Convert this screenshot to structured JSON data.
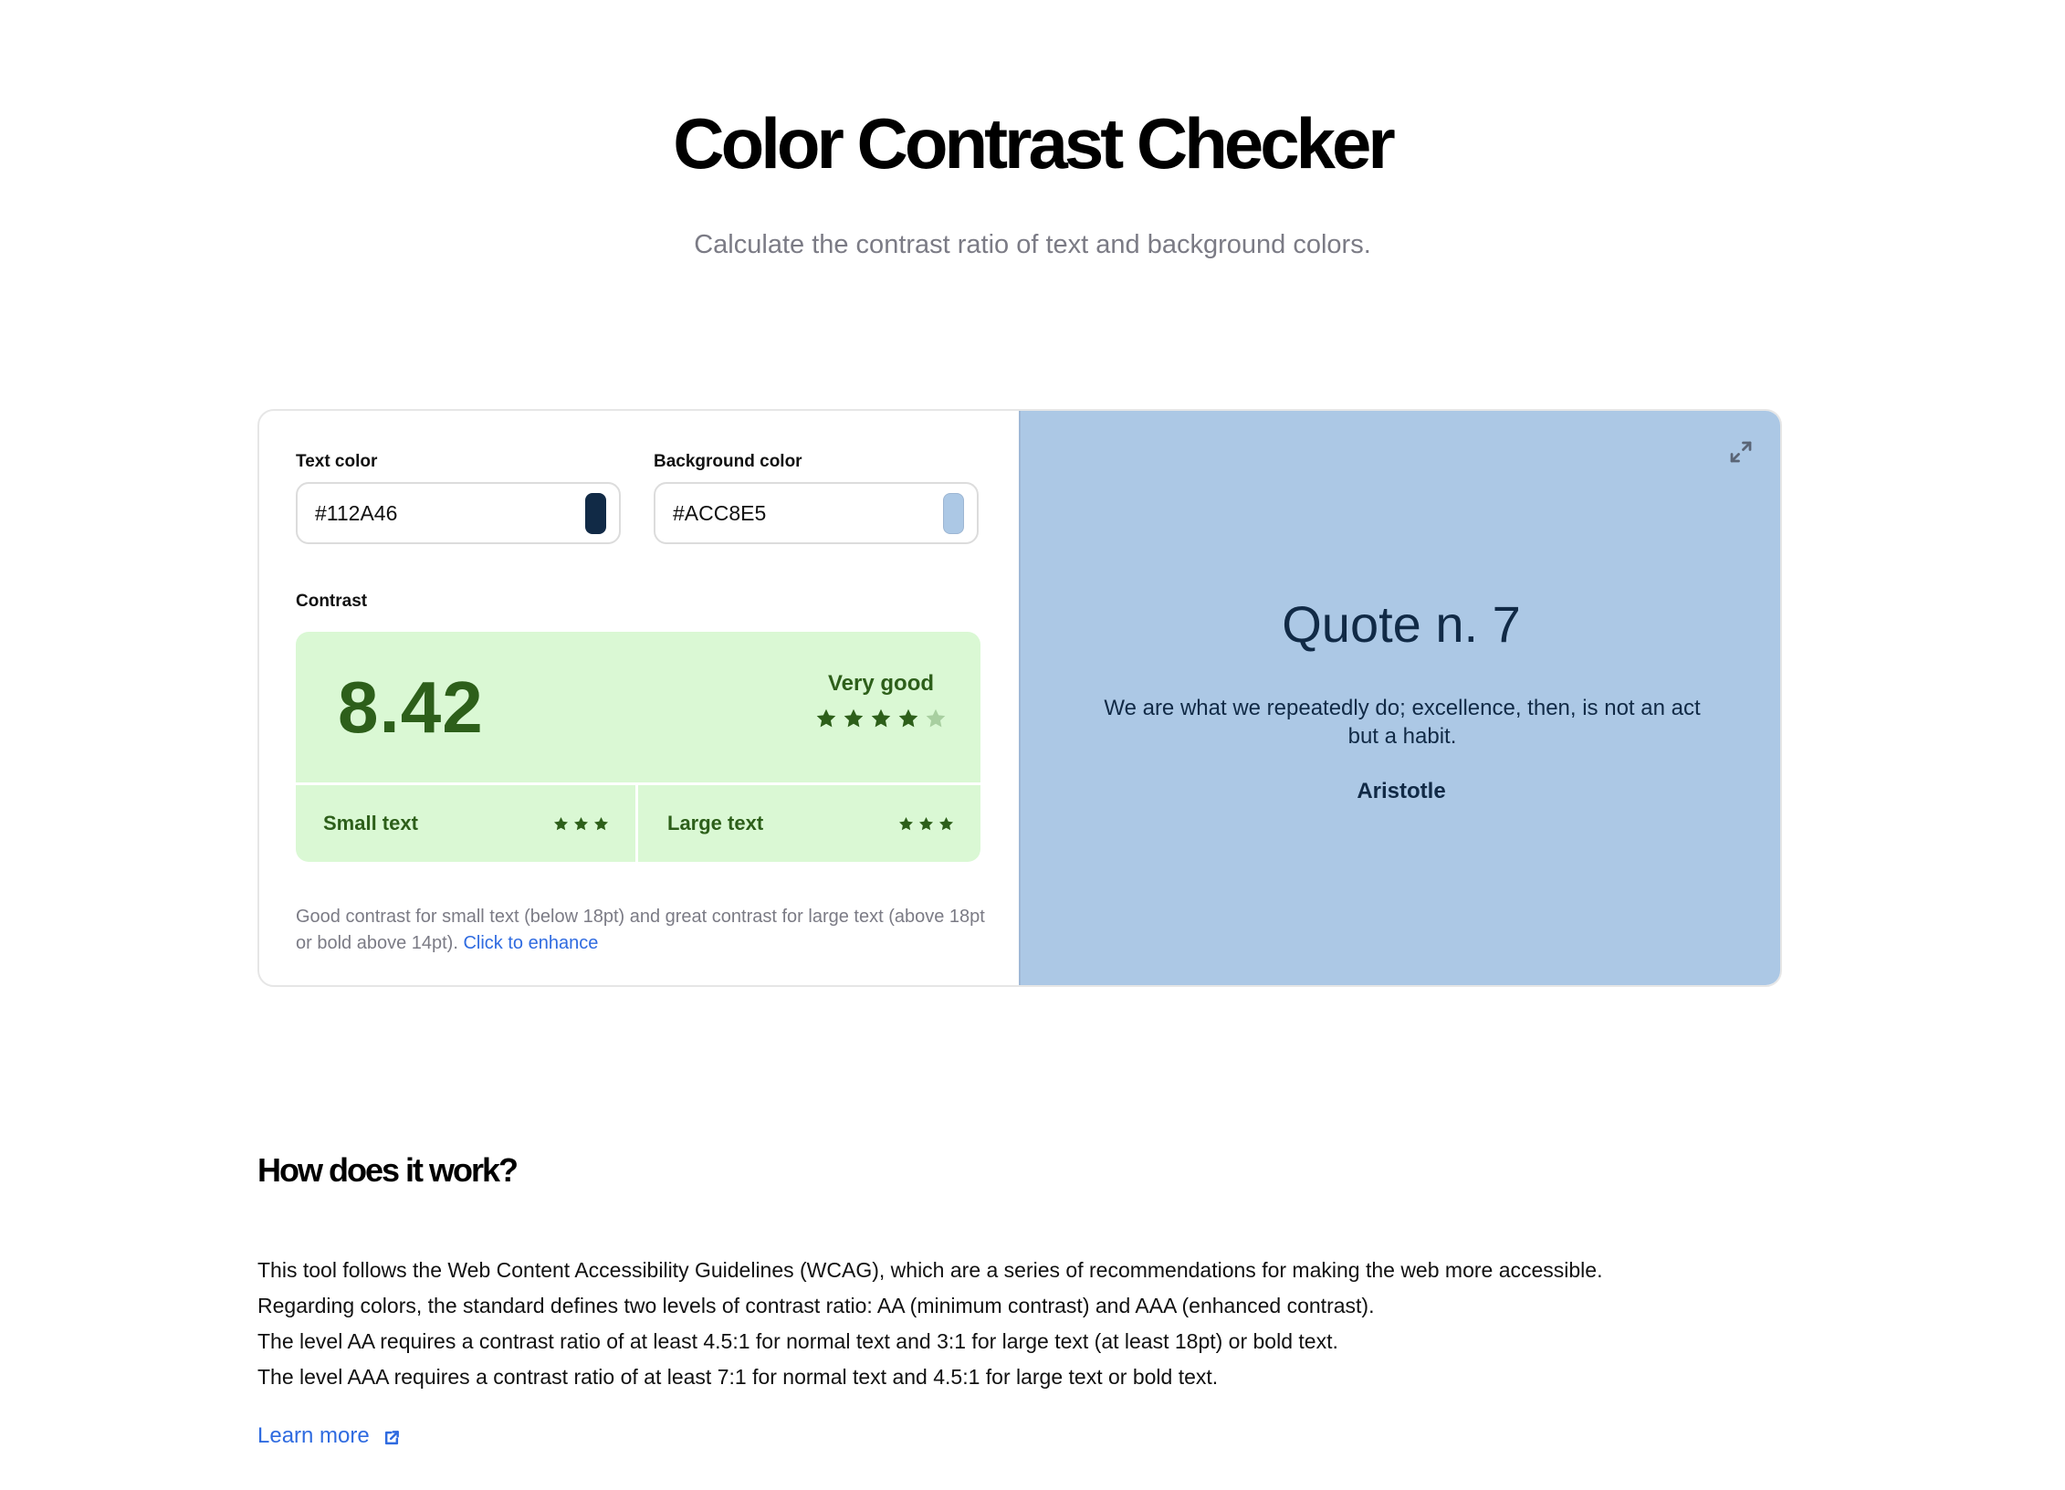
{
  "header": {
    "title": "Color Contrast Checker",
    "subtitle": "Calculate the contrast ratio of text and background colors."
  },
  "checker": {
    "text_color": {
      "label": "Text color",
      "value": "#112A46",
      "swatch": "#112A46"
    },
    "background_color": {
      "label": "Background color",
      "value": "#ACC8E5",
      "swatch": "#ACC8E5"
    },
    "contrast": {
      "label": "Contrast",
      "ratio": "8.42",
      "rating_label": "Very good",
      "rating_stars": 4,
      "rating_max": 5,
      "small_text": {
        "label": "Small text",
        "stars": 3
      },
      "large_text": {
        "label": "Large text",
        "stars": 3
      },
      "colors": {
        "box_bg": "#DAF8D4",
        "fg": "#2D5F1A",
        "star_off": "#A8CFA0"
      }
    },
    "note": {
      "text": "Good contrast for small text (below 18pt) and great contrast for large text (above 18pt or bold above 14pt).",
      "link": "Click to enhance"
    }
  },
  "preview": {
    "icon": "expand-icon",
    "title": "Quote n. 7",
    "quote": "We are what we repeatedly do; excellence, then, is not an act but a habit.",
    "author": "Aristotle"
  },
  "info": {
    "title": "How does it work?",
    "paragraphs": [
      "This tool follows the Web Content Accessibility Guidelines (WCAG), which are a series of recommendations for making the web more accessible.",
      "Regarding colors, the standard defines two levels of contrast ratio: AA (minimum contrast) and AAA (enhanced contrast).",
      "The level AA requires a contrast ratio of at least 4.5:1 for normal text and 3:1 for large text (at least 18pt) or bold text.",
      "The level AAA requires a contrast ratio of at least 7:1 for normal text and 4.5:1 for large text or bold text."
    ],
    "learn_more": "Learn more",
    "learn_more_icon": "external-link-icon"
  }
}
